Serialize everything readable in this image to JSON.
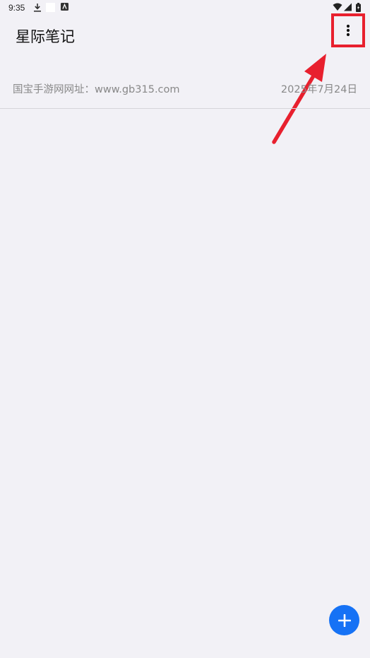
{
  "status_bar": {
    "time": "9:35",
    "icons": [
      "download-icon",
      "white-square-icon",
      "notification-app-icon",
      "wifi-icon",
      "signal-icon",
      "battery-icon"
    ]
  },
  "app": {
    "title": "星际笔记"
  },
  "notes": [
    {
      "title": "国宝手游网网址：www.gb315.com",
      "date": "2025年7月24日"
    }
  ],
  "toolbar": {
    "more_icon": "more-vertical-icon"
  },
  "fab": {
    "icon": "plus-icon"
  },
  "colors": {
    "background": "#f2f1f6",
    "accent": "#1672f5",
    "annotation": "#e8202e",
    "secondary_text": "#888888"
  }
}
